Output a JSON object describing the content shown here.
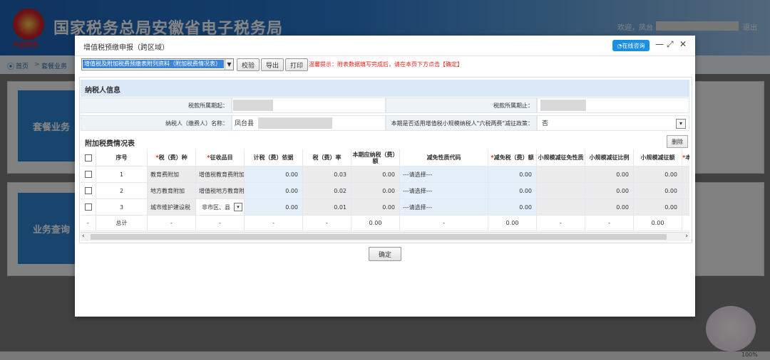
{
  "app": {
    "site_title": "国家税务总局安徽省电子税务局",
    "emblem_text": "中国税务",
    "welcome_text": "欢迎，凤台",
    "logout_label": "退出"
  },
  "breadcrumb": {
    "home": "首页",
    "separator": ">",
    "current": "套餐业务"
  },
  "background_tiles": {
    "package_business": "套餐业务",
    "business_query": "业务查询"
  },
  "status_bar": {
    "zoom": "100%"
  },
  "modal": {
    "title": "增值税预缴申报（跨区域）",
    "online_consult_label": "在线咨询",
    "minimize_label": "—",
    "maximize_label": "⤢",
    "close_label": "✕",
    "toolbar": {
      "form_select_value": "增值税及附加税费预缴表附列资料（附加税费情况表）",
      "verify_label": "校验",
      "export_label": "导出",
      "print_label": "打印",
      "tip_text": "温馨提示：附表数据填写完成后，请在本页下方点击【确定】"
    },
    "taxpayer_section": {
      "title": "纳税人信息",
      "period_start_label": "税款所属期起：",
      "period_end_label": "税款所属期止：",
      "taxpayer_name_label": "纳税人（缴费人）名称：",
      "taxpayer_name_value": "凤台县",
      "policy_label": "本期是否适用增值税小规模纳税人\"六税两费\"减征政策：",
      "policy_value": "否"
    },
    "surcharge_section": {
      "title": "附加税费情况表",
      "delete_label": "删除",
      "columns": [
        "序号",
        "税（费）种",
        "征收品目",
        "计税（费）依据",
        "税（费）率",
        "本期应纳税（费）额",
        "减免性质代码",
        "减免税（费）额",
        "小规模减征免性质",
        "小规模减征比例",
        "小规模减征额",
        "本"
      ],
      "required_marker": "*",
      "rows": [
        {
          "no": "1",
          "tax_type": "教育费附加",
          "item": "增值税教育费附加",
          "basis": "0.00",
          "rate": "0.03",
          "payable": "0.00",
          "relief_code": "---请选择---",
          "relief": "0.00",
          "sm_ratio": "0.00",
          "sm_amount": "0.00"
        },
        {
          "no": "2",
          "tax_type": "地方教育附加",
          "item": "增值税地方教育附加",
          "basis": "0.00",
          "rate": "0.02",
          "payable": "0.00",
          "relief_code": "---请选择---",
          "relief": "0.00",
          "sm_ratio": "0.00",
          "sm_amount": "0.00"
        },
        {
          "no": "3",
          "tax_type": "城市维护建设税",
          "item": "非市区、县",
          "basis": "0.00",
          "rate": "0.01",
          "payable": "0.00",
          "relief_code": "---请选择---",
          "relief": "0.00",
          "sm_ratio": "0.00",
          "sm_amount": "0.00"
        }
      ],
      "total_row": {
        "marker": "-",
        "label": "总计",
        "dash": "-",
        "payable": "0.00",
        "relief": "0.00",
        "sm_amount": "0.00"
      }
    },
    "confirm_label": "确定"
  }
}
